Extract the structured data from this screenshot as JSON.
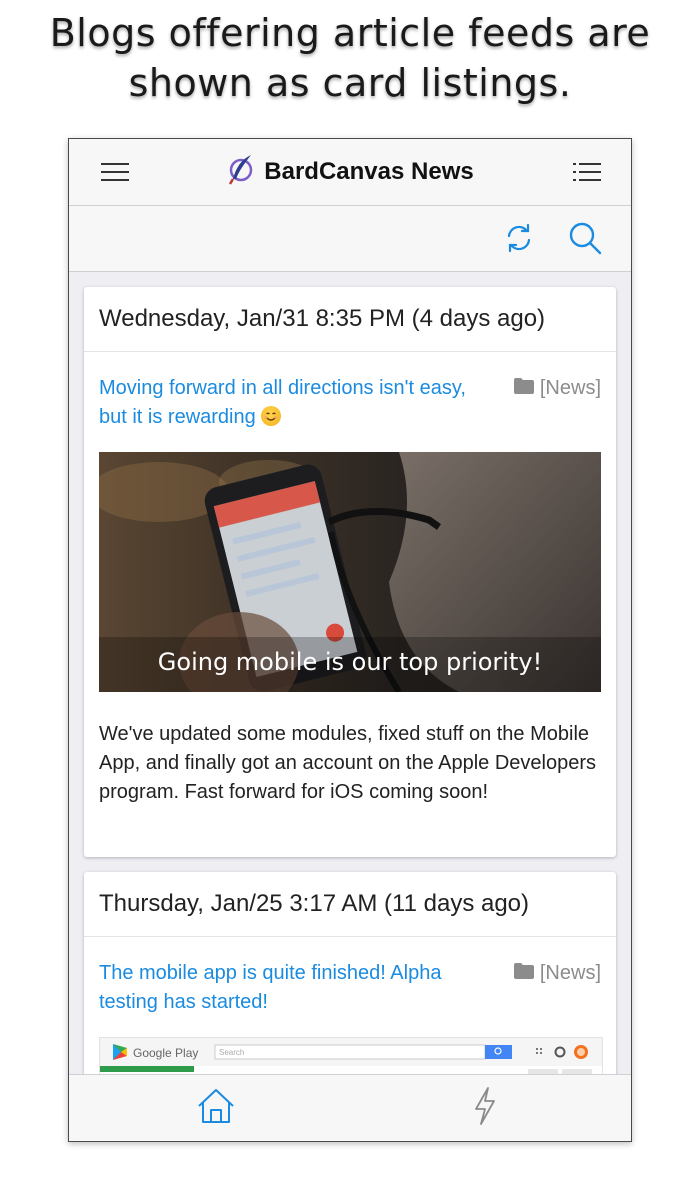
{
  "caption": {
    "line1": "Blogs offering article feeds are",
    "line2": "shown as card listings."
  },
  "app": {
    "title": "BardCanvas News",
    "logo_icon": "quill-logo-icon",
    "menu_icon": "hamburger-menu-icon",
    "list_icon": "list-icon",
    "accent_color": "#1a8be0"
  },
  "toolbar": {
    "refresh_icon": "refresh-icon",
    "search_icon": "search-icon"
  },
  "posts": [
    {
      "date": "Wednesday, Jan/31 8:35 PM (4 days ago)",
      "title": "Moving forward in all directions isn't easy, but it is rewarding",
      "title_emoji": "smiling-face-emoji",
      "category": "[News]",
      "image_caption": "Going mobile is our top priority!",
      "excerpt": "We've updated some modules, fixed stuff on the Mobile App, and finally got an account on the Apple Developers program. Fast forward for iOS coming soon!"
    },
    {
      "date": "Thursday, Jan/25 3:17 AM (11 days ago)",
      "title": "The mobile app is quite finished! Alpha testing has started!",
      "category": "[News]",
      "image_brand": "Google Play",
      "image_search_placeholder": "Search"
    }
  ],
  "tabbar": {
    "home_icon": "home-icon",
    "activity_icon": "lightning-icon"
  }
}
